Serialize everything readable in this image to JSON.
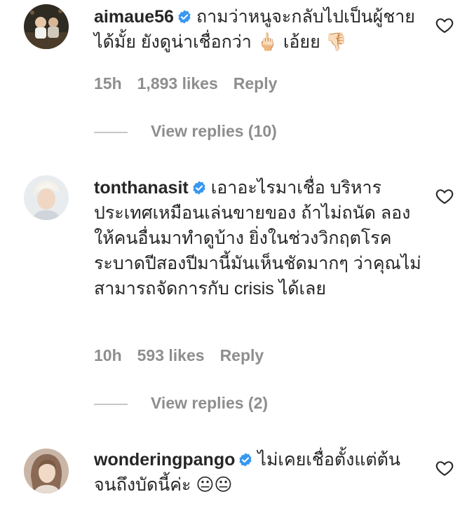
{
  "comments": [
    {
      "username": "aimaue56",
      "verified": true,
      "text": "ถามว่าหนูจะกลับไปเป็นผู้ชายได้มั้ย ยังดูน่าเชื่อกว่า 🖕🏻 เอ้ยย 👎🏻",
      "time": "15h",
      "likes": "1,893 likes",
      "reply_label": "Reply",
      "view_replies": "View replies (10)",
      "avatar_icon": "user-avatar-photo"
    },
    {
      "username": "tonthanasit",
      "verified": true,
      "text": "เอาอะไรมาเชื่อ บริหารประเทศเหมือนเล่นขายของ ถ้าไม่ถนัด ลองให้คนอื่นมาทำดูบ้าง ยิ่งในช่วงวิกฤตโรคระบาดปีสองปีมานี้มันเห็นชัดมากๆ ว่าคุณไม่สามารถจัดการกับ crisis ได้เลย",
      "time": "10h",
      "likes": "593 likes",
      "reply_label": "Reply",
      "view_replies": "View replies (2)",
      "avatar_icon": "user-avatar-photo"
    },
    {
      "username": "wonderingpango",
      "verified": true,
      "text": "ไม่เคยเชื่อตั้งแต่ต้นจนถึงบัดนี้ค่ะ 😐😐",
      "avatar_icon": "user-avatar-photo"
    }
  ],
  "colors": {
    "text": "#262626",
    "muted": "#8e8e8e",
    "verified_blue": "#3897f0",
    "divider": "#c7c7c7"
  },
  "icons": {
    "verified": "verified-badge-icon",
    "like": "heart-outline-icon"
  }
}
